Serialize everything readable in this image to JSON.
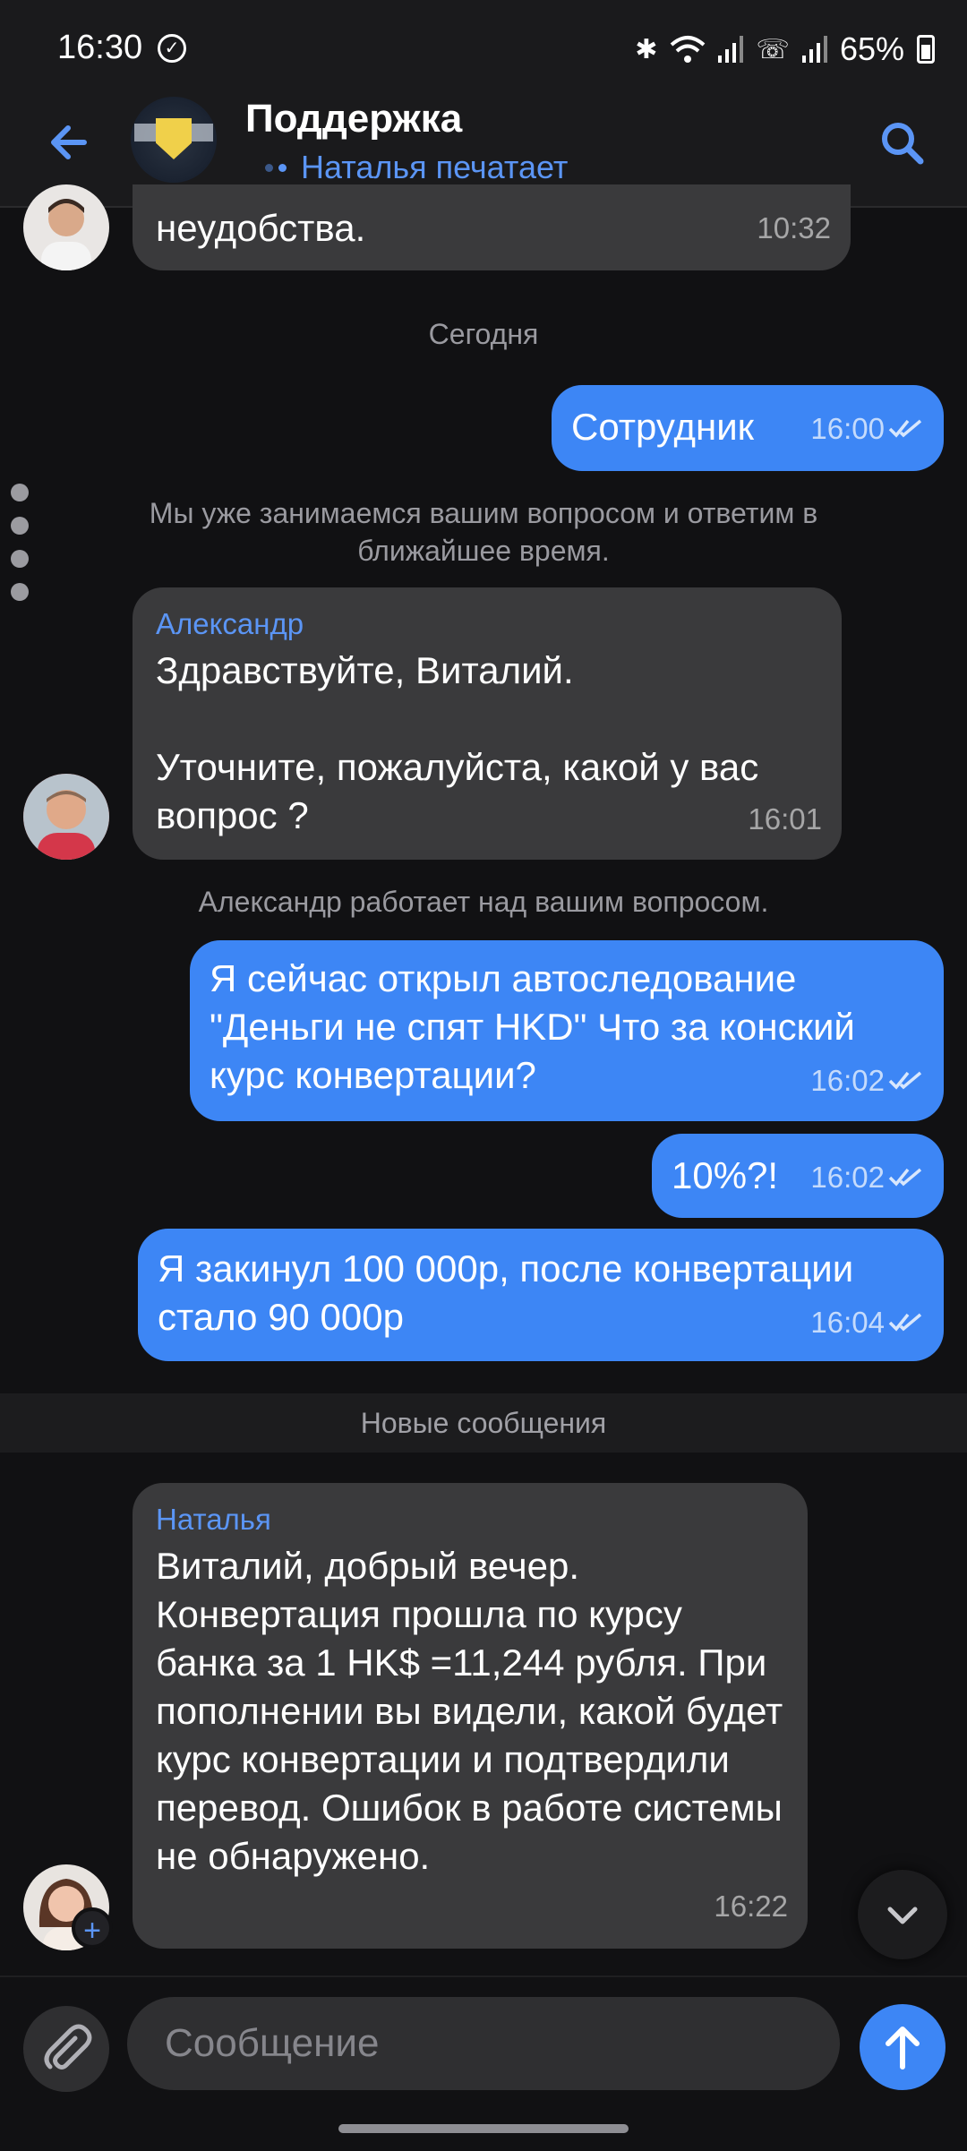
{
  "status_bar": {
    "time": "16:30",
    "battery": "65%"
  },
  "header": {
    "title": "Поддержка",
    "typing_status": "Наталья печатает"
  },
  "messages": [
    {
      "text": "неудобства.",
      "time": "10:32"
    },
    {
      "text": "Сотрудник",
      "time": "16:00"
    },
    {
      "sender": "Александр",
      "text": "Здравствуйте, Виталий.\n\nУточните, пожалуйста, какой у вас вопрос ?",
      "time": "16:01"
    },
    {
      "text": "Я сейчас открыл автоследование \"Деньги не спят HKD\" Что за конский курс конвертации?",
      "time": "16:02"
    },
    {
      "text": "10%?!",
      "time": "16:02"
    },
    {
      "text": "Я закинул 100 000р, после конвертации стало 90 000р",
      "time": "16:04"
    },
    {
      "sender": "Наталья",
      "text": "Виталий, добрый вечер. Конвертация прошла по курсу банка за 1 HK$ =11,244 рубля. При пополнении вы видели, какой будет курс конвертации и подтвердили перевод. Ошибок в работе системы не обнаружено.",
      "time": "16:22"
    }
  ],
  "system": {
    "date_today": "Сегодня",
    "auto_reply": "Мы уже занимаемся вашим вопросом и ответим в ближайшее время.",
    "agent_working": "Александр работает над вашим вопросом.",
    "new_messages": "Новые сообщения"
  },
  "input": {
    "placeholder": "Сообщение"
  },
  "colors": {
    "accent": "#3d86f5",
    "link": "#5b95f5",
    "incoming_bubble": "#3a3a3c",
    "background": "#111113"
  },
  "icons": [
    "back-arrow-icon",
    "search-icon",
    "attach-icon",
    "send-arrow-icon",
    "chevron-down-icon",
    "double-check-icon"
  ]
}
